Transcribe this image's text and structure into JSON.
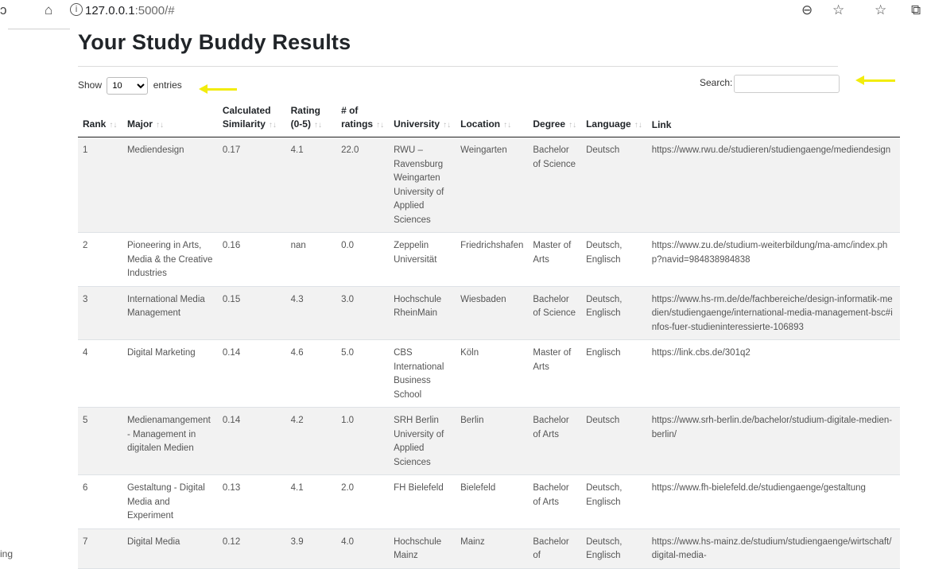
{
  "browser": {
    "url_host": "127.0.0.1",
    "url_rest": ":5000/#"
  },
  "page": {
    "title": "Your Study Buddy Results",
    "show_label": "Show",
    "entries_value": "10",
    "entries_label": "entries",
    "search_label": "Search:",
    "search_value": ""
  },
  "table": {
    "headers": [
      "Rank",
      "Major",
      "Calculated Similarity",
      "Rating (0-5)",
      "# of ratings",
      "University",
      "Location",
      "Degree",
      "Language",
      "Link"
    ],
    "rows": [
      [
        "1",
        "Mediendesign",
        "0.17",
        "4.1",
        "22.0",
        "RWU – Ravensburg Weingarten University of Applied Sciences",
        "Weingarten",
        "Bachelor of Science",
        "Deutsch",
        "https://www.rwu.de/studieren/studiengaenge/mediendesign"
      ],
      [
        "2",
        "Pioneering in Arts, Media & the Creative Industries",
        "0.16",
        "nan",
        "0.0",
        "Zeppelin Universität",
        "Friedrichshafen",
        "Master of Arts",
        "Deutsch, Englisch",
        "https://www.zu.de/studium-weiterbildung/ma-amc/index.php?navid=984838984838"
      ],
      [
        "3",
        "International Media Management",
        "0.15",
        "4.3",
        "3.0",
        "Hochschule RheinMain",
        "Wiesbaden",
        "Bachelor of Science",
        "Deutsch, Englisch",
        "https://www.hs-rm.de/de/fachbereiche/design-informatik-medien/studiengaenge/international-media-management-bsc#infos-fuer-studieninteressierte-106893"
      ],
      [
        "4",
        "Digital Marketing",
        "0.14",
        "4.6",
        "5.0",
        "CBS International Business School",
        "Köln",
        "Master of Arts",
        "Englisch",
        "https://link.cbs.de/301q2"
      ],
      [
        "5",
        "Medienamangement - Management in digitalen Medien",
        "0.14",
        "4.2",
        "1.0",
        "SRH Berlin University of Applied Sciences",
        "Berlin",
        "Bachelor of Arts",
        "Deutsch",
        "https://www.srh-berlin.de/bachelor/studium-digitale-medien-berlin/"
      ],
      [
        "6",
        "Gestaltung - Digital Media and Experiment",
        "0.13",
        "4.1",
        "2.0",
        "FH Bielefeld",
        "Bielefeld",
        "Bachelor of Arts",
        "Deutsch, Englisch",
        "https://www.fh-bielefeld.de/studiengaenge/gestaltung"
      ],
      [
        "7",
        "Digital Media",
        "0.12",
        "3.9",
        "4.0",
        "Hochschule Mainz",
        "Mainz",
        "Bachelor of",
        "Deutsch, Englisch",
        "https://www.hs-mainz.de/studium/studiengaenge/wirtschaft/digital-media-"
      ]
    ]
  },
  "stray_text": "ing",
  "colors": {
    "arrow": "#f2ec0c",
    "circle": "#39b54a"
  },
  "icons": [
    "back-icon",
    "home-icon",
    "info-icon",
    "zoom-out-icon",
    "favorite-add-icon",
    "favorites-icon",
    "collections-icon",
    "sort-icon"
  ]
}
